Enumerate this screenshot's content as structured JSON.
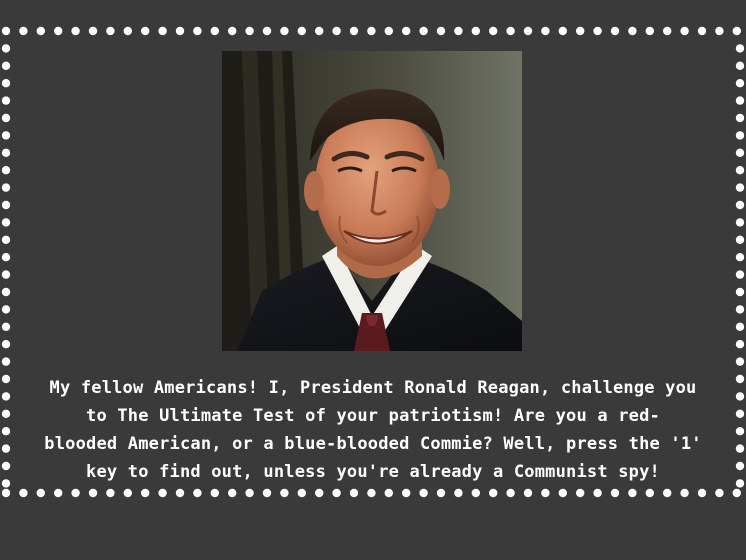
{
  "screen": {
    "background_color": "#3a3a3a",
    "border_dot_color": "#ffffff",
    "text_color": "#ffffff"
  },
  "portrait": {
    "subject": "president-reagan-portrait",
    "icon": "portrait-photo"
  },
  "dialog": {
    "lines": [
      "My fellow Americans! I, President Ronald Reagan, challenge you",
      "to The Ultimate Test of your patriotism! Are you a red-",
      "blooded American, or a blue-blooded Commie? Well, press the '1'",
      "key to find out, unless you're already a Communist spy!"
    ]
  }
}
